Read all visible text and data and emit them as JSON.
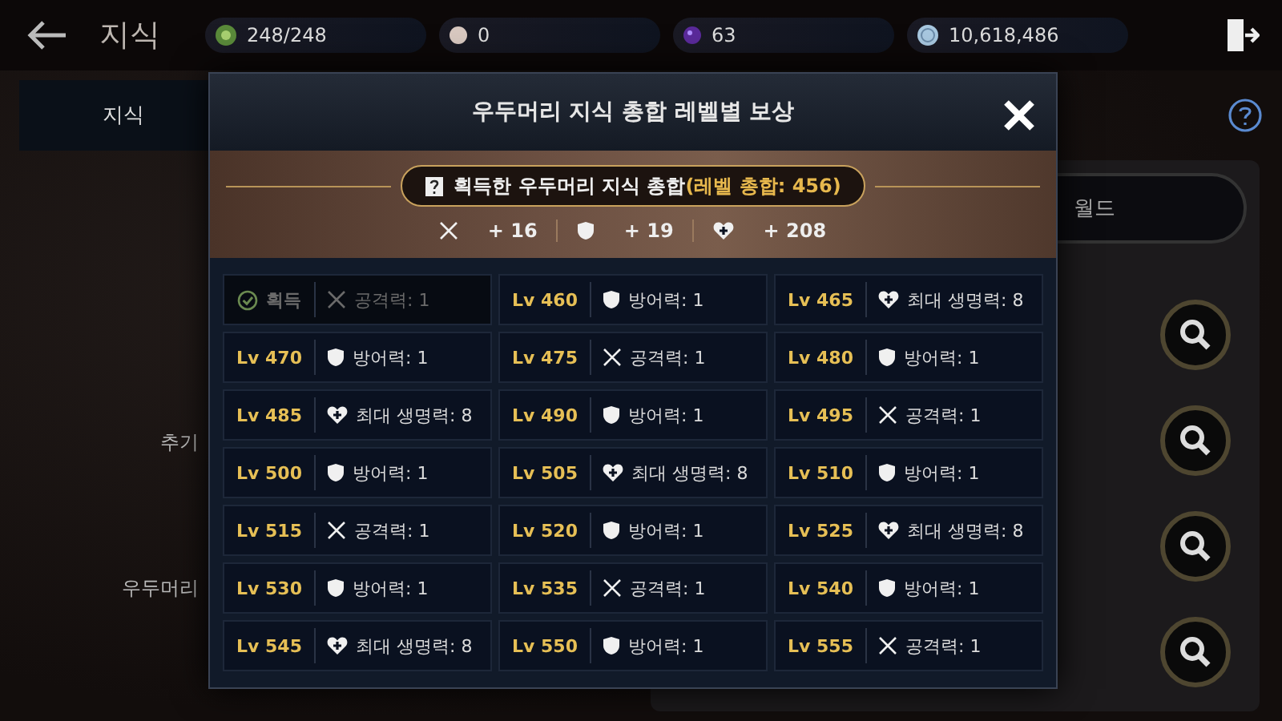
{
  "header": {
    "title": "지식",
    "currencies": [
      {
        "kind": "stamina",
        "value": "248/248"
      },
      {
        "kind": "pearl",
        "value": "0"
      },
      {
        "kind": "orb",
        "value": "63"
      },
      {
        "kind": "silver",
        "value": "10,618,486"
      }
    ]
  },
  "tabs": [
    {
      "label": "지식",
      "selected": true
    },
    {
      "label": "월드",
      "selected": false
    }
  ],
  "side_labels": [
    "추기",
    "우두머리"
  ],
  "modal": {
    "title": "우두머리 지식 총합 레벨별 보상",
    "summary": {
      "label": "획득한 우두머리 지식 총합",
      "total": "(레벨 총합: 456)",
      "bonuses": [
        {
          "kind": "attack",
          "value": "+ 16"
        },
        {
          "kind": "defense",
          "value": "+ 19"
        },
        {
          "kind": "health",
          "value": "+ 208"
        }
      ]
    },
    "rewards": [
      {
        "label": "획득",
        "acquired": true,
        "stat": {
          "kind": "attack",
          "text": "공격력: 1"
        }
      },
      {
        "label": "Lv 460",
        "acquired": false,
        "stat": {
          "kind": "defense",
          "text": "방어력: 1"
        }
      },
      {
        "label": "Lv 465",
        "acquired": false,
        "stat": {
          "kind": "health",
          "text": "최대 생명력: 8"
        }
      },
      {
        "label": "Lv 470",
        "acquired": false,
        "stat": {
          "kind": "defense",
          "text": "방어력: 1"
        }
      },
      {
        "label": "Lv 475",
        "acquired": false,
        "stat": {
          "kind": "attack",
          "text": "공격력: 1"
        }
      },
      {
        "label": "Lv 480",
        "acquired": false,
        "stat": {
          "kind": "defense",
          "text": "방어력: 1"
        }
      },
      {
        "label": "Lv 485",
        "acquired": false,
        "stat": {
          "kind": "health",
          "text": "최대 생명력: 8"
        }
      },
      {
        "label": "Lv 490",
        "acquired": false,
        "stat": {
          "kind": "defense",
          "text": "방어력: 1"
        }
      },
      {
        "label": "Lv 495",
        "acquired": false,
        "stat": {
          "kind": "attack",
          "text": "공격력: 1"
        }
      },
      {
        "label": "Lv 500",
        "acquired": false,
        "stat": {
          "kind": "defense",
          "text": "방어력: 1"
        }
      },
      {
        "label": "Lv 505",
        "acquired": false,
        "stat": {
          "kind": "health",
          "text": "최대 생명력: 8"
        }
      },
      {
        "label": "Lv 510",
        "acquired": false,
        "stat": {
          "kind": "defense",
          "text": "방어력: 1"
        }
      },
      {
        "label": "Lv 515",
        "acquired": false,
        "stat": {
          "kind": "attack",
          "text": "공격력: 1"
        }
      },
      {
        "label": "Lv 520",
        "acquired": false,
        "stat": {
          "kind": "defense",
          "text": "방어력: 1"
        }
      },
      {
        "label": "Lv 525",
        "acquired": false,
        "stat": {
          "kind": "health",
          "text": "최대 생명력: 8"
        }
      },
      {
        "label": "Lv 530",
        "acquired": false,
        "stat": {
          "kind": "defense",
          "text": "방어력: 1"
        }
      },
      {
        "label": "Lv 535",
        "acquired": false,
        "stat": {
          "kind": "attack",
          "text": "공격력: 1"
        }
      },
      {
        "label": "Lv 540",
        "acquired": false,
        "stat": {
          "kind": "defense",
          "text": "방어력: 1"
        }
      },
      {
        "label": "Lv 545",
        "acquired": false,
        "stat": {
          "kind": "health",
          "text": "최대 생명력: 8"
        }
      },
      {
        "label": "Lv 550",
        "acquired": false,
        "stat": {
          "kind": "defense",
          "text": "방어력: 1"
        }
      },
      {
        "label": "Lv 555",
        "acquired": false,
        "stat": {
          "kind": "attack",
          "text": "공격력: 1"
        }
      }
    ]
  }
}
